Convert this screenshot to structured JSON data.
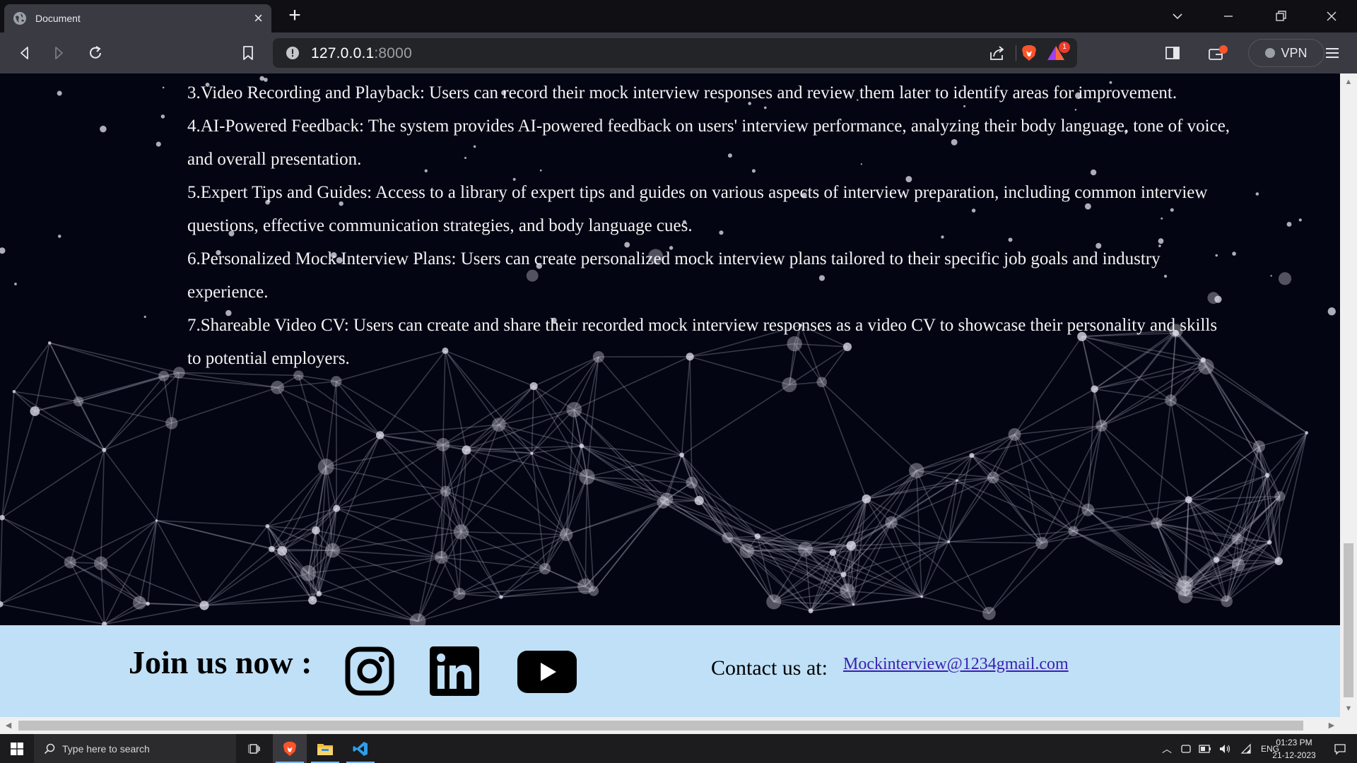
{
  "browser": {
    "tab_title": "Document",
    "url_host": "127.0.0.1",
    "url_port": ":8000",
    "rewards_badge": "1",
    "vpn_label": "VPN"
  },
  "content": {
    "features": [
      "3.Video Recording and Playback: Users can record their mock interview responses and review them later to identify areas for improvement.",
      "4.AI-Powered Feedback: The system provides AI-powered feedback on users' interview performance, analyzing their body language, tone of voice, and overall presentation.",
      "5.Expert Tips and Guides: Access to a library of expert tips and guides on various aspects of interview preparation, including common interview questions, effective communication strategies, and body language cues.",
      "6.Personalized Mock Interview Plans: Users can create personalized mock interview plans tailored to their specific job goals and industry experience.",
      "7.Shareable Video CV: Users can create and share their recorded mock interview responses as a video CV to showcase their personality and skills to potential employers."
    ]
  },
  "footer": {
    "join_label": "Join us now :",
    "social_icons": [
      "instagram-icon",
      "linkedin-icon",
      "youtube-icon"
    ],
    "contact_label": "Contact us at:",
    "contact_email": "Mockinterview@1234gmail.com"
  },
  "taskbar": {
    "search_placeholder": "Type here to search",
    "language": "ENG",
    "time": "01:23 PM",
    "date": "21-12-2023"
  },
  "colors": {
    "page_background": "#040512",
    "footer_background": "#bfe0f7",
    "link_color": "#3a1fb0"
  }
}
